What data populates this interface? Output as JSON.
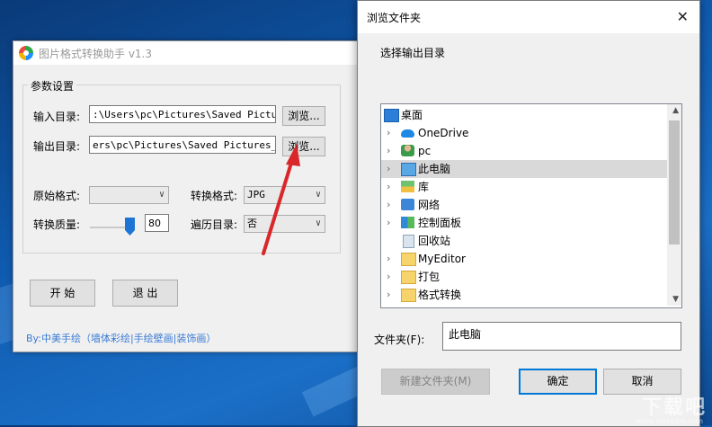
{
  "app": {
    "title": "图片格式转换助手 v1.3",
    "group_label": "参数设置",
    "input_dir_label": "输入目录:",
    "input_dir_value": ":\\Users\\pc\\Pictures\\Saved Pictures",
    "input_browse": "浏览...",
    "output_dir_label": "输出目录:",
    "output_dir_value": "ers\\pc\\Pictures\\Saved Pictures_out",
    "output_browse": "浏览...",
    "source_format_label": "原始格式:",
    "source_format_value": "",
    "target_format_label": "转换格式:",
    "target_format_value": "JPG",
    "quality_label": "转换质量:",
    "quality_value": "80",
    "traverse_label": "遍历目录:",
    "traverse_value": "否",
    "start_button": "开 始",
    "exit_button": "退 出",
    "footer": "By:中美手绘（墙体彩绘|手绘壁画|装饰画）"
  },
  "dialog": {
    "title": "浏览文件夹",
    "close": "✕",
    "description": "选择输出目录",
    "tree": [
      {
        "label": "桌面",
        "icon": "desktop-icon",
        "expandable": false,
        "selected": false
      },
      {
        "label": "OneDrive",
        "icon": "cloud-icon",
        "expandable": true,
        "selected": false
      },
      {
        "label": "pc",
        "icon": "user-icon",
        "expandable": true,
        "selected": false
      },
      {
        "label": "此电脑",
        "icon": "computer-icon",
        "expandable": true,
        "selected": true
      },
      {
        "label": "库",
        "icon": "library-icon",
        "expandable": true,
        "selected": false
      },
      {
        "label": "网络",
        "icon": "network-icon",
        "expandable": true,
        "selected": false
      },
      {
        "label": "控制面板",
        "icon": "control-panel-icon",
        "expandable": true,
        "selected": false
      },
      {
        "label": "回收站",
        "icon": "recycle-bin-icon",
        "expandable": false,
        "selected": false
      },
      {
        "label": "MyEditor",
        "icon": "folder-icon",
        "expandable": true,
        "selected": false
      },
      {
        "label": "打包",
        "icon": "folder-icon",
        "expandable": true,
        "selected": false
      },
      {
        "label": "格式转换",
        "icon": "folder-icon",
        "expandable": true,
        "selected": false
      }
    ],
    "folder_label": "文件夹(F):",
    "folder_value": "此电脑",
    "new_folder_button": "新建文件夹(M)",
    "ok_button": "确定",
    "cancel_button": "取消"
  },
  "watermark": {
    "text": "下载吧",
    "sub": "www.xiazaiba.com"
  },
  "colors": {
    "accent": "#0078d7",
    "annotation_arrow": "#d9262a",
    "footer_link": "#3a7bd5"
  }
}
